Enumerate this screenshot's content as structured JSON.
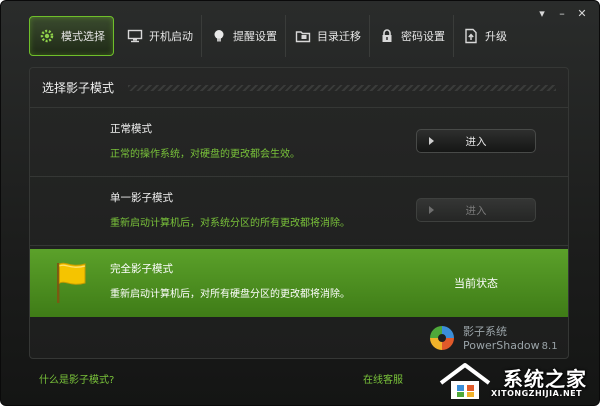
{
  "window": {
    "controls": {
      "minimize": "–",
      "pin": "▾",
      "close": "✕"
    }
  },
  "toolbar": {
    "tabs": [
      {
        "label": "模式选择",
        "icon": "gear-icon",
        "active": true
      },
      {
        "label": "开机启动",
        "icon": "monitor-icon",
        "active": false
      },
      {
        "label": "提醒设置",
        "icon": "lightbulb-icon",
        "active": false
      },
      {
        "label": "目录迁移",
        "icon": "folder-icon",
        "active": false
      },
      {
        "label": "密码设置",
        "icon": "lock-icon",
        "active": false
      },
      {
        "label": "升级",
        "icon": "upgrade-icon",
        "active": false
      }
    ]
  },
  "panel": {
    "title": "选择影子模式",
    "modes": [
      {
        "title": "正常模式",
        "desc": "正常的操作系统，对硬盘的更改都会生效。",
        "button": "进入",
        "enabled": true
      },
      {
        "title": "单一影子模式",
        "desc": "重新启动计算机后，对系统分区的所有更改都将消除。",
        "button": "进入",
        "enabled": false
      },
      {
        "title": "完全影子模式",
        "desc": "重新启动计算机后，对所有硬盘分区的更改都将消除。",
        "status": "当前状态",
        "active": true
      }
    ]
  },
  "brand": {
    "name": "影子系统",
    "product": "PowerShadow",
    "version": "8.1"
  },
  "footer": {
    "help_link": "什么是影子模式?",
    "support_link": "在线客服"
  },
  "watermark": {
    "text": "系统之家",
    "url": "XITONGZHIJIA.NET"
  },
  "colors": {
    "accent": "#79c23a",
    "active_bg": "#4e8e22",
    "panel_bg": "#222322"
  }
}
